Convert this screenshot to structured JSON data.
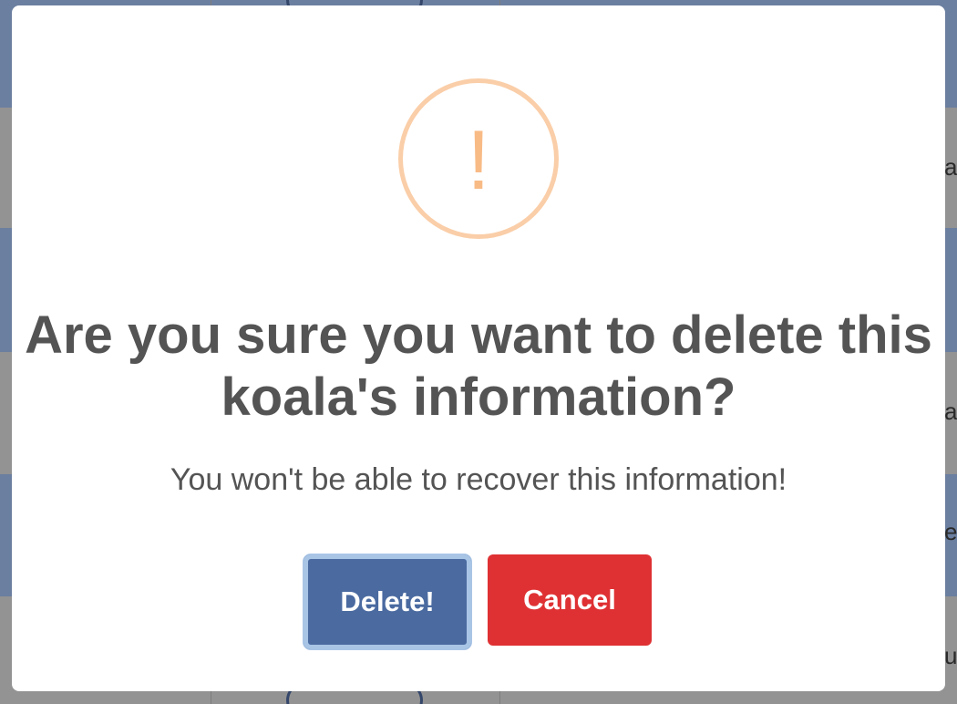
{
  "dialog": {
    "title": "Are you sure you want to delete this koala's information?",
    "text": "You won't be able to recover this information!",
    "icon": "warning-icon",
    "icon_glyph": "!",
    "confirm_label": "Delete!",
    "cancel_label": "Cancel"
  },
  "background": {
    "edge_texts": [
      "a",
      "a",
      "e",
      "u"
    ]
  },
  "colors": {
    "confirm": "#4a6aa0",
    "cancel": "#df3133",
    "warning_ring": "#facea8",
    "warning_mark": "#f8bb86",
    "text": "#545454"
  }
}
